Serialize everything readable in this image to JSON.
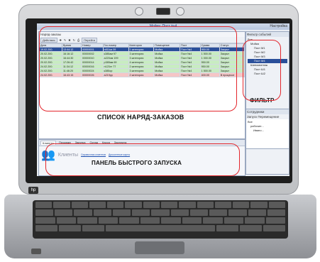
{
  "window": {
    "title": "Мойка: Пост №4",
    "right_label": "Настройка"
  },
  "main": {
    "title": "Наряд-заказы",
    "toolbar": {
      "actions_label": "Действия",
      "goto_label": "Перейти"
    },
    "columns": [
      "Дата",
      "Время",
      "Номер",
      "Гос.номер",
      "Категория",
      "Помещение",
      "Пост",
      "Сумма",
      "Статус"
    ],
    "rows": [
      {
        "cells": [
          "19.02.200.",
          "13:44:12",
          "00000001",
          "н811ка 09",
          "1 категория",
          "Мойка",
          "Пост №4",
          "950.00",
          "Закрыт"
        ],
        "style": "row-sel"
      },
      {
        "cells": [
          "20.02.200.",
          "16:16:12",
          "00000002",
          "к385ам 97",
          "3 категория",
          "Мойка",
          "Пост №4",
          "1 500.00",
          "Закрыт"
        ],
        "style": "row-green"
      },
      {
        "cells": [
          "20.02.200.",
          "16:44:30",
          "00000010",
          "а220ом 199",
          "3 категория",
          "Мойка",
          "Пост №4",
          "1 000.00",
          "Закрыт"
        ],
        "style": "row-green"
      },
      {
        "cells": [
          "20.02.200.",
          "17:26:42",
          "00000014",
          "р385ам 69",
          "4 категория",
          "Мойка",
          "Пост №4",
          "950.00",
          "Закрыт"
        ],
        "style": "row-green"
      },
      {
        "cells": [
          "24.02.200.",
          "11:34:12",
          "00000016",
          "н123хт 77",
          "2 категория",
          "Мойка",
          "Пост №4",
          "950.00",
          "Закрыт"
        ],
        "style": "row-green"
      },
      {
        "cells": [
          "24.02.200.",
          "11:46:20",
          "00000024",
          "к385ор",
          "3 категория",
          "Мойка",
          "Пост №4",
          "1 500.00",
          "Закрыт"
        ],
        "style": "row-green"
      },
      {
        "cells": [
          "24.02.200.",
          "16:43:15",
          "00000026",
          "а219рр",
          "2 категория",
          "Мойка",
          "Пост №4",
          "400.00",
          "В процессе"
        ],
        "style": "row-pink"
      }
    ],
    "overlay": "СПИСОК НАРЯД-ЗАКАЗОВ"
  },
  "filter": {
    "title": "Фильтр событий",
    "tree": [
      "Все",
      "Мойка",
      "Пост М1",
      "Пост М2",
      "Пост М3",
      "Пост М4",
      "Шиномонтаж",
      "Пост Ш1",
      "Пост Ш2"
    ],
    "overlay": "ФИЛЬТР"
  },
  "staff": {
    "title": "Сотрудники",
    "filter_label": "Запуск   Перемещение",
    "tree": [
      "Все",
      "рабочие...",
      "Ивано..."
    ]
  },
  "quick": {
    "tabs": [
      "Клиенты",
      "Продажи",
      "Закупка",
      "Склад",
      "Касса",
      "Зарплата"
    ],
    "title": "Клиенты",
    "links": [
      "Справочник клиентов",
      "Дисконтные карты"
    ],
    "overlay": "ПАНЕЛЬ БЫСТРОГО ЗАПУСКА"
  },
  "colors": {
    "accent": "#e3262c",
    "selected": "#2a4f9a",
    "green_row": "#c8ecc2",
    "pink_row": "#f5c6c6"
  }
}
